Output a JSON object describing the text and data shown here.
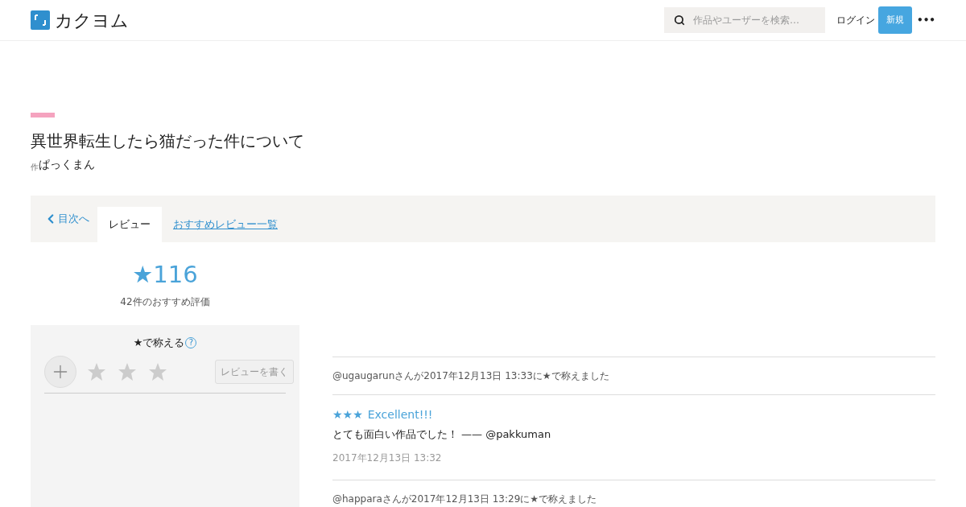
{
  "header": {
    "logo_text": "カクヨム",
    "search": {
      "placeholder": "作品やユーザーを検索…"
    },
    "login": "ログイン",
    "signup": "新規",
    "menu": "•••"
  },
  "work": {
    "title": "異世界転生したら猫だった件について",
    "author_prefix": "作",
    "author": "ぱっくまん"
  },
  "nav": {
    "back": "目次へ",
    "tabs": [
      {
        "label": "レビュー",
        "selected": true
      },
      {
        "label": "おすすめレビュー一覧",
        "selected": false
      }
    ]
  },
  "stats": {
    "stars": "★116",
    "reviewers": "42件のおすすめ評価"
  },
  "rate_panel": {
    "heading": "★で称える",
    "help": "?",
    "stars": 0,
    "write": "レビューを書く"
  },
  "reviews": [
    {
      "kind": "star",
      "user": "@ugaugarun",
      "text": "さんが2017年12月13日 13:33に★で称えました"
    },
    {
      "kind": "review",
      "stars": 3,
      "title": "Excellent!!!",
      "body": "とても面白い作品でした！",
      "author": "—— @pakkuman",
      "date": "2017年12月13日 13:32"
    },
    {
      "kind": "star",
      "user": "@happara",
      "text": "さんが2017年12月13日 13:29に★で称えました"
    }
  ]
}
